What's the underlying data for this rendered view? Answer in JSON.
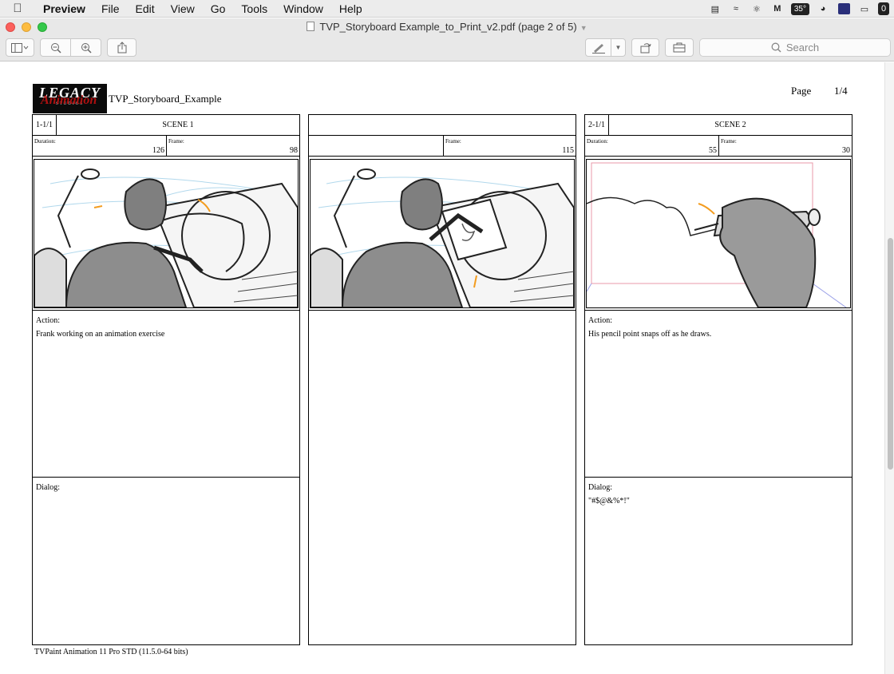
{
  "menubar": {
    "app": "Preview",
    "items": [
      "File",
      "Edit",
      "View",
      "Go",
      "Tools",
      "Window",
      "Help"
    ],
    "temperature": "35°"
  },
  "window": {
    "title": "TVP_Storyboard Example_to_Print_v2.pdf (page 2 of 5)"
  },
  "toolbar": {
    "search_placeholder": "Search"
  },
  "document": {
    "logo_text": "LEGACY",
    "logo_subtext": "STUDIOS",
    "logo_script": "Animation",
    "title": "TVP_Storyboard_Example",
    "page_label": "Page",
    "page_number": "1/4",
    "panels": [
      {
        "shot": "1-1/1",
        "scene": "SCENE 1",
        "duration_label": "Duration:",
        "duration": "126",
        "frame_label": "Frame:",
        "frame": "98",
        "action_label": "Action:",
        "action": "Frank working on an animation exercise",
        "dialog_label": "Dialog:",
        "dialog": ""
      },
      {
        "shot": "",
        "scene": "",
        "duration_label": "",
        "duration": "",
        "frame_label": "Frame:",
        "frame": "115",
        "action_label": "",
        "action": "",
        "dialog_label": "",
        "dialog": ""
      },
      {
        "shot": "2-1/1",
        "scene": "SCENE 2",
        "duration_label": "Duration:",
        "duration": "55",
        "frame_label": "Frame:",
        "frame": "30",
        "action_label": "Action:",
        "action": "His pencil point snaps off as he draws.",
        "dialog_label": "Dialog:",
        "dialog": "\"#$@&%*!\""
      }
    ],
    "footer": "TVPaint Animation 11 Pro STD (11.5.0-64 bits)"
  }
}
